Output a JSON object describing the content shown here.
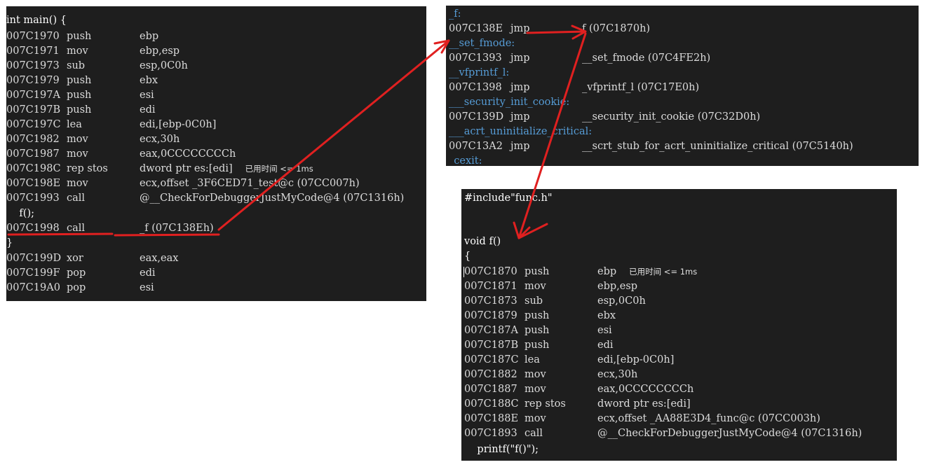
{
  "colors": {
    "background": "#1e1e1e",
    "label": "#569cd6",
    "arrow": "#e02020"
  },
  "main_panel": {
    "header": "int main() {",
    "rows": [
      {
        "addr": "007C1970",
        "mn": "push",
        "op": "ebp"
      },
      {
        "addr": "007C1971",
        "mn": "mov",
        "op": "ebp,esp"
      },
      {
        "addr": "007C1973",
        "mn": "sub",
        "op": "esp,0C0h"
      },
      {
        "addr": "007C1979",
        "mn": "push",
        "op": "ebx"
      },
      {
        "addr": "007C197A",
        "mn": "push",
        "op": "esi"
      },
      {
        "addr": "007C197B",
        "mn": "push",
        "op": "edi"
      },
      {
        "addr": "007C197C",
        "mn": "lea",
        "op": "edi,[ebp-0C0h]"
      },
      {
        "addr": "007C1982",
        "mn": "mov",
        "op": "ecx,30h"
      },
      {
        "addr": "007C1987",
        "mn": "mov",
        "op": "eax,0CCCCCCCCh"
      },
      {
        "addr": "007C198C",
        "mn": "rep stos",
        "op": "dword ptr es:[edi]",
        "hint": "已用时间 <= 1ms"
      },
      {
        "addr": "007C198E",
        "mn": "mov",
        "op": "ecx,offset _3F6CED71_test@c (07CC007h)"
      },
      {
        "addr": "007C1993",
        "mn": "call",
        "op": "@__CheckForDebuggerJustMyCode@4 (07C1316h)"
      }
    ],
    "src_call": "    f();",
    "call_row": {
      "addr": "007C1998",
      "mn": "call",
      "op": "_f (07C138Eh)"
    },
    "close_brace": "}",
    "tail_rows": [
      {
        "addr": "007C199D",
        "mn": "xor",
        "op": "eax,eax"
      },
      {
        "addr": "007C199F",
        "mn": "pop",
        "op": "edi"
      },
      {
        "addr": "007C19A0",
        "mn": "pop",
        "op": "esi"
      }
    ]
  },
  "thunk_panel": {
    "rows": [
      {
        "label": "_f:"
      },
      {
        "addr": "007C138E",
        "mn": "jmp",
        "op": "f (07C1870h)"
      },
      {
        "label": "__set_fmode:"
      },
      {
        "addr": "007C1393",
        "mn": "jmp",
        "op": "__set_fmode (07C4FE2h)"
      },
      {
        "label": "__vfprintf_l:"
      },
      {
        "addr": "007C1398",
        "mn": "jmp",
        "op": "_vfprintf_l (07C17E0h)"
      },
      {
        "label": "___security_init_cookie:"
      },
      {
        "addr": "007C139D",
        "mn": "jmp",
        "op": "__security_init_cookie (07C32D0h)"
      },
      {
        "label": "___acrt_uninitialize_critical:"
      },
      {
        "addr": "007C13A2",
        "mn": "jmp",
        "op": "__scrt_stub_for_acrt_uninitialize_critical (07C5140h)"
      },
      {
        "label": "_cexit:"
      }
    ]
  },
  "func_panel": {
    "include": "#include\"func.h\"",
    "signature": "void f()",
    "open_brace": "{",
    "rows": [
      {
        "addr": "007C1870",
        "mn": "push",
        "op": "ebp",
        "hint": "已用时间 <= 1ms"
      },
      {
        "addr": "007C1871",
        "mn": "mov",
        "op": "ebp,esp"
      },
      {
        "addr": "007C1873",
        "mn": "sub",
        "op": "esp,0C0h"
      },
      {
        "addr": "007C1879",
        "mn": "push",
        "op": "ebx"
      },
      {
        "addr": "007C187A",
        "mn": "push",
        "op": "esi"
      },
      {
        "addr": "007C187B",
        "mn": "push",
        "op": "edi"
      },
      {
        "addr": "007C187C",
        "mn": "lea",
        "op": "edi,[ebp-0C0h]"
      },
      {
        "addr": "007C1882",
        "mn": "mov",
        "op": "ecx,30h"
      },
      {
        "addr": "007C1887",
        "mn": "mov",
        "op": "eax,0CCCCCCCCh"
      },
      {
        "addr": "007C188C",
        "mn": "rep stos",
        "op": "dword ptr es:[edi]"
      },
      {
        "addr": "007C188E",
        "mn": "mov",
        "op": "ecx,offset _AA88E3D4_func@c (07CC003h)"
      },
      {
        "addr": "007C1893",
        "mn": "call",
        "op": "@__CheckForDebuggerJustMyCode@4 (07C1316h)"
      }
    ],
    "src_printf": "    printf(\"f()\");"
  }
}
